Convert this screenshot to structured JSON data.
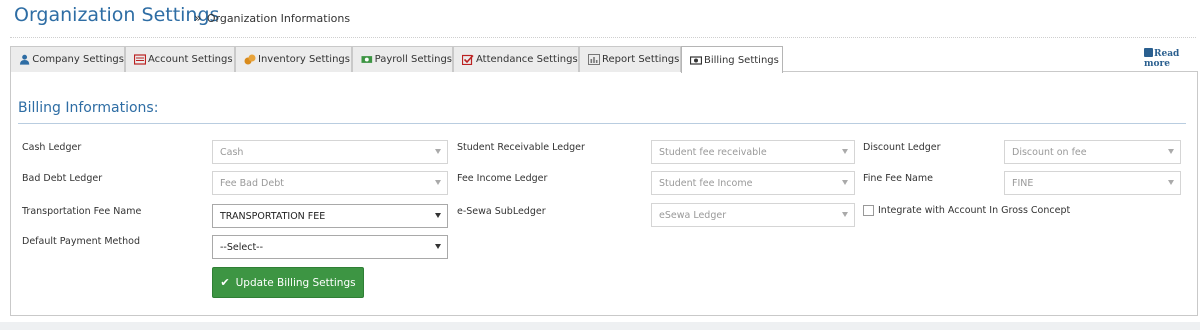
{
  "header": {
    "title": "Organization Settings",
    "breadcrumb": "Organization Informations"
  },
  "read_more": "Read more",
  "tabs": [
    {
      "label": "Company Settings",
      "icon": "user-icon"
    },
    {
      "label": "Account Settings",
      "icon": "account-book-icon"
    },
    {
      "label": "Inventory Settings",
      "icon": "coins-icon"
    },
    {
      "label": "Payroll Settings",
      "icon": "money-icon"
    },
    {
      "label": "Attendance Settings",
      "icon": "check-square-icon"
    },
    {
      "label": "Report Settings",
      "icon": "bar-chart-icon"
    },
    {
      "label": "Billing Settings",
      "icon": "billing-icon",
      "active": true
    }
  ],
  "section": {
    "title": "Billing Informations:"
  },
  "fields": {
    "cash_ledger": {
      "label": "Cash Ledger",
      "value": "Cash"
    },
    "student_receivable_ledger": {
      "label": "Student Receivable Ledger",
      "value": "Student fee receivable"
    },
    "discount_ledger": {
      "label": "Discount Ledger",
      "value": "Discount on fee"
    },
    "bad_debt_ledger": {
      "label": "Bad Debt Ledger",
      "value": "Fee Bad Debt"
    },
    "fee_income_ledger": {
      "label": "Fee Income Ledger",
      "value": "Student fee Income"
    },
    "fine_fee_name": {
      "label": "Fine Fee Name",
      "value": "FINE"
    },
    "transportation_fee_name": {
      "label": "Transportation Fee Name",
      "value": "TRANSPORTATION FEE"
    },
    "esewa_subledger": {
      "label": "e-Sewa SubLedger",
      "value": "eSewa Ledger"
    },
    "integrate_gross": {
      "label": "Integrate with Account In Gross Concept",
      "checked": false
    },
    "default_payment_method": {
      "label": "Default Payment Method",
      "value": "--Select--"
    }
  },
  "update_button": "Update Billing Settings",
  "colors": {
    "accent": "#2e6da4",
    "button": "#3d9543"
  }
}
